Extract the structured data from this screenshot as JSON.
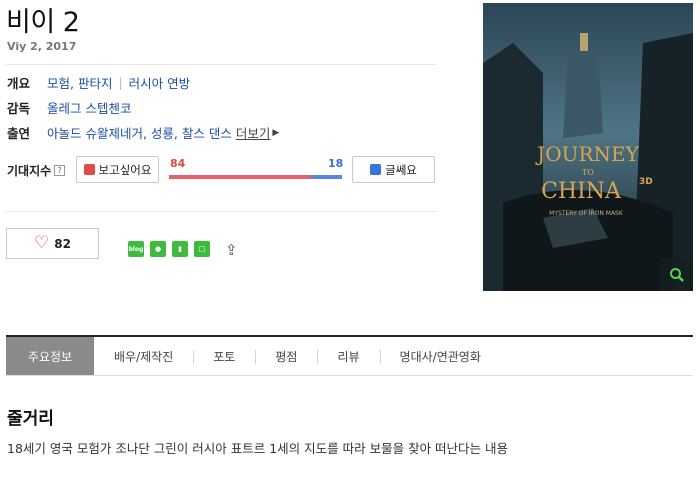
{
  "movie": {
    "title": "비이 2",
    "release": "Viy 2, 2017"
  },
  "info": {
    "overview_label": "개요",
    "genre": "모험, 판타지",
    "country": "러시아 연방",
    "director_label": "감독",
    "director": "올레그 스텝첸코",
    "cast_label": "출연",
    "cast": "아놀드 슈왈제네거, 성룡, 찰스 댄스",
    "more_label": "더보기"
  },
  "expectation": {
    "label": "기대지수",
    "help": "?",
    "want_button": "보고싶어요",
    "no_button": "글쎄요",
    "want_count": "84",
    "no_count": "18",
    "want_fraction": 0.82
  },
  "like": {
    "count": "82"
  },
  "share": {
    "icons": [
      "blog-icon",
      "talk-icon",
      "bookmark-icon",
      "band-icon",
      "share-out-icon"
    ],
    "blog_text": "blog"
  },
  "poster": {
    "line1": "JOURNEY",
    "line2": "TO",
    "line3": "CHINA",
    "tag": "3D",
    "subtitle": "MYSTERY OF IRON MASK",
    "zoom_icon": "zoom-icon"
  },
  "tabs": [
    "주요정보",
    "배우/제작진",
    "포토",
    "평점",
    "리뷰",
    "명대사/연관영화"
  ],
  "plot": {
    "heading": "줄거리",
    "text": "18세기 영국 모험가 조나단 그린이 러시아 표트르 1세의 지도를 따라 보물을 찾아 떠난다는 내용"
  },
  "colors": {
    "link": "#1a4ea8",
    "want": "#e8606a",
    "no": "#5b86df",
    "active_tab": "#8a8a8a"
  }
}
